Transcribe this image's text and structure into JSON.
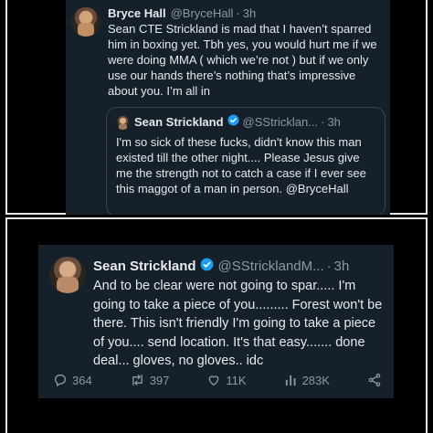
{
  "top_tweet": {
    "author_name": "Bryce Hall",
    "handle": "@BryceHall",
    "separator": "·",
    "time": "3h",
    "text": "Sean CTE Strickland is mad that I haven’t sparred him in boxing yet. Tbh yes, you would hurt me if we were doing MMA ( which we’re not ) but if we only use our hands there’s nothing that’s impressive about you. I’m all in",
    "quoted": {
      "author_name": "Sean Strickland",
      "handle": "@SStricklan...",
      "separator": "·",
      "time": "3h",
      "text": "I'm so sick of these fucks, didn't know this man existed till the other night.... Please Jesus give me the strength not to catch a case if I ever see this maggot of a man in person. @BryceHall"
    }
  },
  "bottom_tweet": {
    "author_name": "Sean Strickland",
    "handle": "@SStricklandM...",
    "separator": "·",
    "time": "3h",
    "text": "And to be clear were not going to spar..... I'm going to take a piece of you......... Forest won't be there. This isn't friendly I'm going to take a piece of you.... send location. It's that easy....... done deal... gloves, no gloves.. idc",
    "actions": {
      "replies": "364",
      "reposts": "397",
      "likes": "11K",
      "views": "283K"
    }
  },
  "colors": {
    "tweet_bg": "#15202b",
    "text": "#e7e9ea",
    "muted": "#8b98a5",
    "verified": "#1d9bf0",
    "panel_border": "#e7e7e7"
  }
}
